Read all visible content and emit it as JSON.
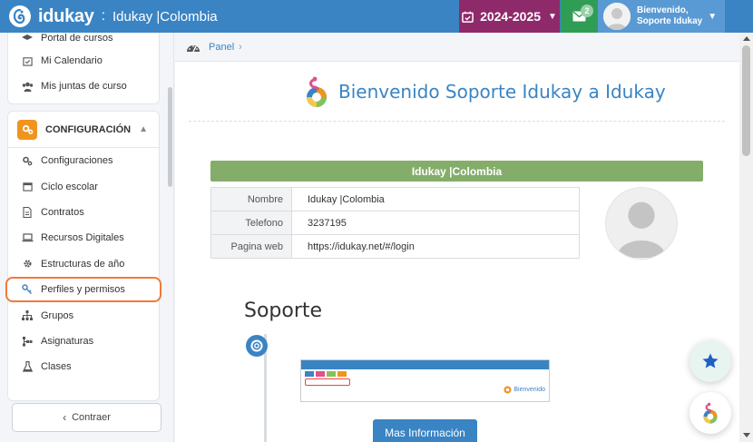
{
  "header": {
    "brand": "idukay",
    "separator": ":",
    "school": "Idukay |Colombia",
    "year": "2024-2025",
    "messages_count": "2",
    "user_greeting": "Bienvenido,",
    "user_name": "Soporte Idukay",
    "colors": {
      "bar": "#3a84c4",
      "year": "#8f2a6a",
      "messages": "#2f9e54",
      "user": "#5a9ad4"
    }
  },
  "sidebar": {
    "top_items": [
      {
        "label": "Portal de cursos",
        "icon": "graduation-icon"
      },
      {
        "label": "Mi Calendario",
        "icon": "calendar-check-icon"
      },
      {
        "label": "Mis juntas de curso",
        "icon": "users-icon"
      }
    ],
    "section_title": "CONFIGURACIÓN",
    "section_items": [
      {
        "label": "Configuraciones",
        "icon": "gears-icon"
      },
      {
        "label": "Ciclo escolar",
        "icon": "calendar-icon"
      },
      {
        "label": "Contratos",
        "icon": "document-icon"
      },
      {
        "label": "Recursos Digitales",
        "icon": "laptop-icon"
      },
      {
        "label": "Estructuras de año",
        "icon": "gear-icon"
      },
      {
        "label": "Perfiles y permisos",
        "icon": "key-icon"
      },
      {
        "label": "Grupos",
        "icon": "sitemap-icon"
      },
      {
        "label": "Asignaturas",
        "icon": "tree-icon"
      },
      {
        "label": "Clases",
        "icon": "flask-icon"
      }
    ],
    "active_item": "Perfiles y permisos",
    "collapse_label": "Contraer"
  },
  "breadcrumb": {
    "label": "Panel",
    "separator": "›"
  },
  "main": {
    "welcome": "Bienvenido Soporte Idukay a Idukay",
    "school_bar": "Idukay |Colombia",
    "info": [
      {
        "label": "Nombre",
        "value": "Idukay |Colombia"
      },
      {
        "label": "Telefono",
        "value": "3237195"
      },
      {
        "label": "Pagina web",
        "value": "https://idukay.net/#/login"
      }
    ],
    "support_title": "Soporte",
    "more_button": "Mas Información",
    "thumb_welcome": "Bienvenido"
  }
}
